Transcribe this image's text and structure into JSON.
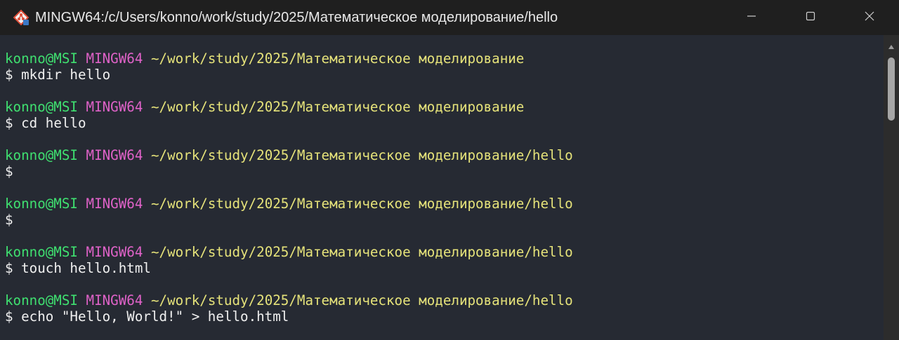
{
  "window": {
    "title": "MINGW64:/c/Users/konno/work/study/2025/Математическое моделирование/hello"
  },
  "controls": {
    "minimize_icon": "minimize-icon",
    "maximize_icon": "maximize-icon",
    "close_icon": "close-icon"
  },
  "colors": {
    "user": "#3fe070",
    "mingw": "#df62c8",
    "path": "#e6e37a",
    "background": "#262a33"
  },
  "terminal": {
    "entries": [
      {
        "user": "konno@MSI",
        "env": "MINGW64",
        "path": "~/work/study/2025/Математическое моделирование",
        "prompt": "$",
        "command": " mkdir hello"
      },
      {
        "user": "konno@MSI",
        "env": "MINGW64",
        "path": "~/work/study/2025/Математическое моделирование",
        "prompt": "$",
        "command": " cd hello"
      },
      {
        "user": "konno@MSI",
        "env": "MINGW64",
        "path": "~/work/study/2025/Математическое моделирование/hello",
        "prompt": "$",
        "command": ""
      },
      {
        "user": "konno@MSI",
        "env": "MINGW64",
        "path": "~/work/study/2025/Математическое моделирование/hello",
        "prompt": "$",
        "command": ""
      },
      {
        "user": "konno@MSI",
        "env": "MINGW64",
        "path": "~/work/study/2025/Математическое моделирование/hello",
        "prompt": "$",
        "command": " touch hello.html"
      },
      {
        "user": "konno@MSI",
        "env": "MINGW64",
        "path": "~/work/study/2025/Математическое моделирование/hello",
        "prompt": "$",
        "command": " echo \"Hello, World!\" > hello.html"
      }
    ]
  }
}
